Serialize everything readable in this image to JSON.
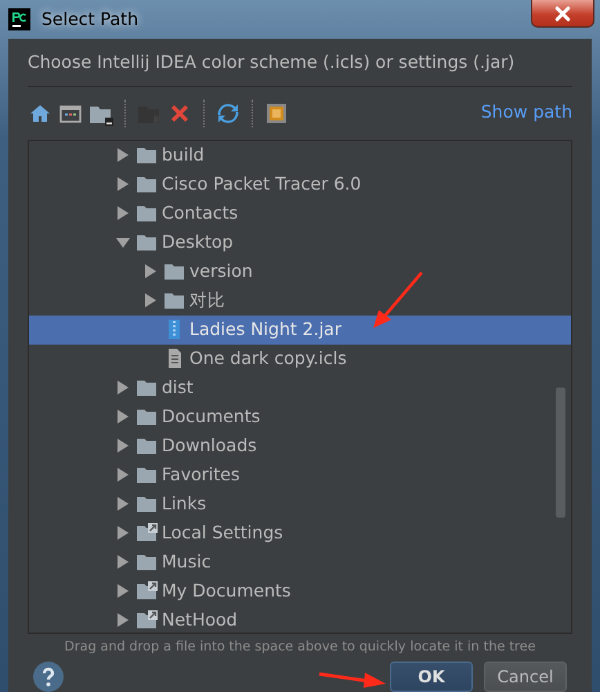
{
  "window": {
    "title": "Select Path"
  },
  "prompt": "Choose Intellij IDEA color scheme (.icls) or settings (.jar)",
  "toolbar": [
    {
      "kind": "home",
      "disabled": false
    },
    {
      "kind": "desktop",
      "disabled": false
    },
    {
      "kind": "project",
      "disabled": false
    },
    {
      "kind": "separator"
    },
    {
      "kind": "new-folder",
      "disabled": true
    },
    {
      "kind": "delete",
      "disabled": false
    },
    {
      "kind": "separator"
    },
    {
      "kind": "refresh",
      "disabled": false
    },
    {
      "kind": "separator"
    },
    {
      "kind": "hidden",
      "disabled": false
    }
  ],
  "show_path_link": "Show path",
  "tree": [
    {
      "name": "build",
      "kind": "folder",
      "expanded": false,
      "selected": false
    },
    {
      "name": "Cisco Packet Tracer 6.0",
      "kind": "folder",
      "expanded": false,
      "selected": false
    },
    {
      "name": "Contacts",
      "kind": "folder",
      "expanded": false,
      "selected": false
    },
    {
      "name": "Desktop",
      "kind": "folder",
      "expanded": true,
      "selected": false,
      "children": [
        {
          "name": "version",
          "kind": "folder",
          "expanded": false,
          "selected": false
        },
        {
          "name": "对比",
          "kind": "folder",
          "expanded": false,
          "selected": false
        },
        {
          "name": "Ladies Night 2.jar",
          "kind": "jar",
          "selected": true
        },
        {
          "name": "One dark copy.icls",
          "kind": "file",
          "selected": false
        }
      ]
    },
    {
      "name": "dist",
      "kind": "folder",
      "expanded": false,
      "selected": false
    },
    {
      "name": "Documents",
      "kind": "folder",
      "expanded": false,
      "selected": false
    },
    {
      "name": "Downloads",
      "kind": "folder",
      "expanded": false,
      "selected": false
    },
    {
      "name": "Favorites",
      "kind": "folder",
      "expanded": false,
      "selected": false
    },
    {
      "name": "Links",
      "kind": "folder",
      "expanded": false,
      "selected": false
    },
    {
      "name": "Local Settings",
      "kind": "link",
      "expanded": false,
      "selected": false
    },
    {
      "name": "Music",
      "kind": "folder",
      "expanded": false,
      "selected": false
    },
    {
      "name": "My Documents",
      "kind": "link",
      "expanded": false,
      "selected": false
    },
    {
      "name": "NetHood",
      "kind": "link",
      "expanded": false,
      "selected": false
    }
  ],
  "hint": "Drag and drop a file into the space above to quickly locate it in the tree",
  "buttons": [
    {
      "label": "OK",
      "default": true
    },
    {
      "label": "Cancel",
      "default": false
    }
  ]
}
